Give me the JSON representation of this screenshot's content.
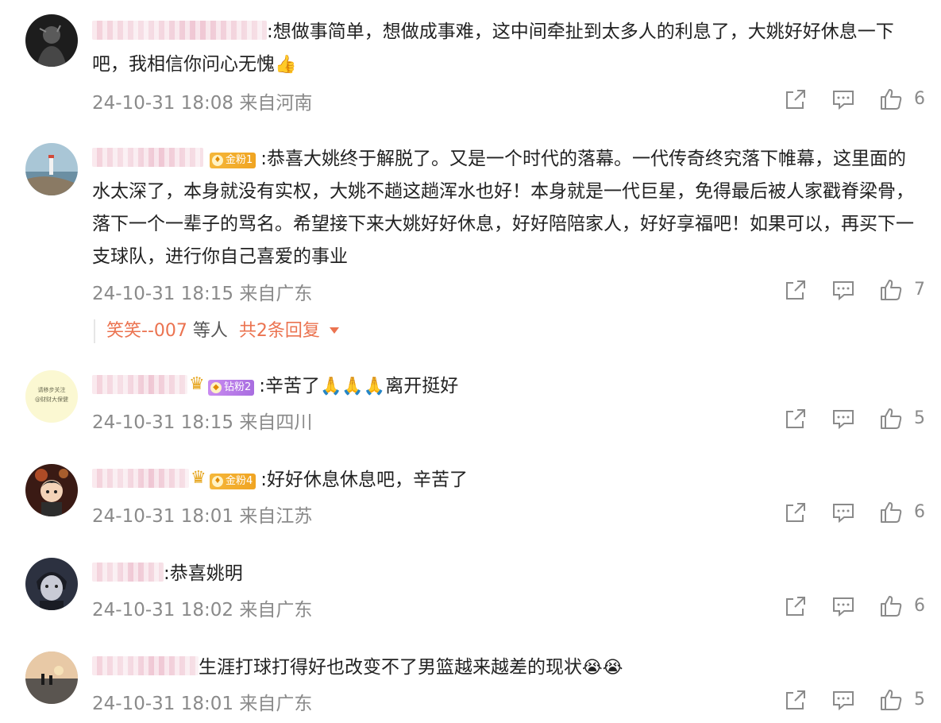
{
  "comments": [
    {
      "text": ":想做事简单，想做成事难，这中间牵扯到太多人的利息了，大姚好好休息一下吧，我相信你问心无愧",
      "emoji": "👍",
      "time": "24-10-31 18:08",
      "location": "来自河南",
      "likes": "6",
      "avatar_icon": "dark-portrait"
    },
    {
      "badge": "金粉1",
      "text": ":恭喜大姚终于解脱了。又是一个时代的落幕。一代传奇终究落下帷幕，这里面的水太深了，本身就没有实权，大姚不趟这趟浑水也好！本身就是一代巨星，免得最后被人家戳脊梁骨，落下一个一辈子的骂名。希望接下来大姚好好休息，好好陪陪家人，好好享福吧！如果可以，再买下一支球队，进行你自己喜爱的事业",
      "time": "24-10-31 18:15",
      "location": "来自广东",
      "likes": "7",
      "replies": {
        "name": "笑笑--007",
        "middle": " 等人",
        "total": "共2条回复"
      },
      "avatar_icon": "lighthouse-scene"
    },
    {
      "badge": "钻粉2",
      "text": ":辛苦了",
      "emoji": "🙏🙏🙏",
      "text_after": "离开挺好",
      "time": "24-10-31 18:15",
      "location": "来自四川",
      "likes": "5",
      "avatar_text": [
        "请移步关注",
        "@财财大保健"
      ]
    },
    {
      "badge": "金粉4",
      "text": ":好好休息休息吧，辛苦了",
      "time": "24-10-31 18:01",
      "location": "来自江苏",
      "likes": "6",
      "avatar_icon": "cartoon-boy"
    },
    {
      "text": ":恭喜姚明",
      "time": "24-10-31 18:02",
      "location": "来自广东",
      "likes": "6",
      "avatar_icon": "anime-character"
    },
    {
      "text": "生涯打球打得好也改变不了男篮越来越差的现状",
      "emoji": "😭😭",
      "time": "24-10-31 18:01",
      "location": "来自广东",
      "likes": "5",
      "avatar_icon": "sunset-silhouette"
    }
  ],
  "colors": {
    "text": "#222222",
    "meta": "#8a8a8a",
    "accent": "#eb7350",
    "gold_badge": "#f5b73a",
    "diamond_badge": "#b67ae6"
  }
}
